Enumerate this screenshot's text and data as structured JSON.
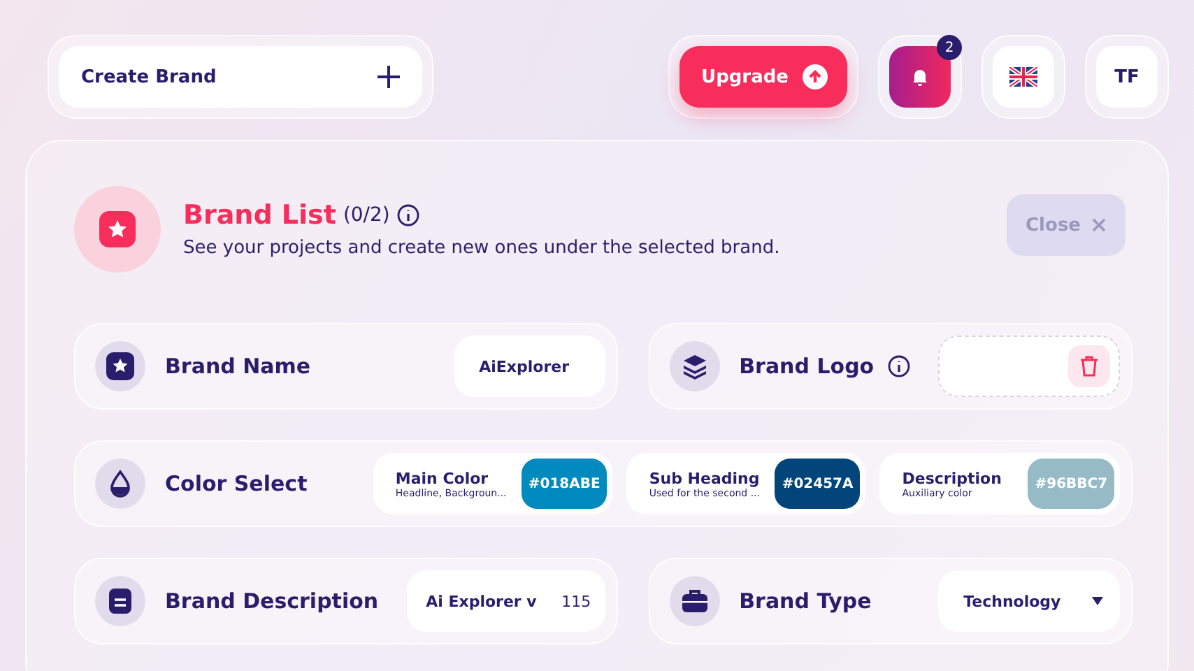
{
  "topbar": {
    "create_button": "Create Brand",
    "upgrade_button": "Upgrade",
    "notification_count": "2",
    "avatar_initials": "TF"
  },
  "header": {
    "title": "Brand List",
    "count": "(0/2)",
    "subtitle": "See your projects and create new ones under the selected brand.",
    "close_button": "Close"
  },
  "fields": [
    {
      "kind": "text",
      "label": "Brand Name",
      "value": "AiExplorer"
    },
    {
      "kind": "logo",
      "label": "Brand Logo"
    },
    {
      "kind": "colors",
      "label": "Color Select",
      "swatches": [
        {
          "name": "Main Color",
          "hint": "Headline, Backgroun...",
          "hex": "#018ABE",
          "color": "#018abe"
        },
        {
          "name": "Sub Heading",
          "hint": "Used for the second ...",
          "hex": "#02457A",
          "color": "#02457a"
        },
        {
          "name": "Description",
          "hint": "Auxiliary color",
          "hex": "#96BBC7",
          "color": "#96bbc7"
        }
      ]
    },
    {
      "kind": "textcount",
      "label": "Brand Description",
      "value": "Ai Explorer v",
      "counter": "115"
    },
    {
      "kind": "select",
      "label": "Brand Type",
      "value": "Technology"
    }
  ]
}
